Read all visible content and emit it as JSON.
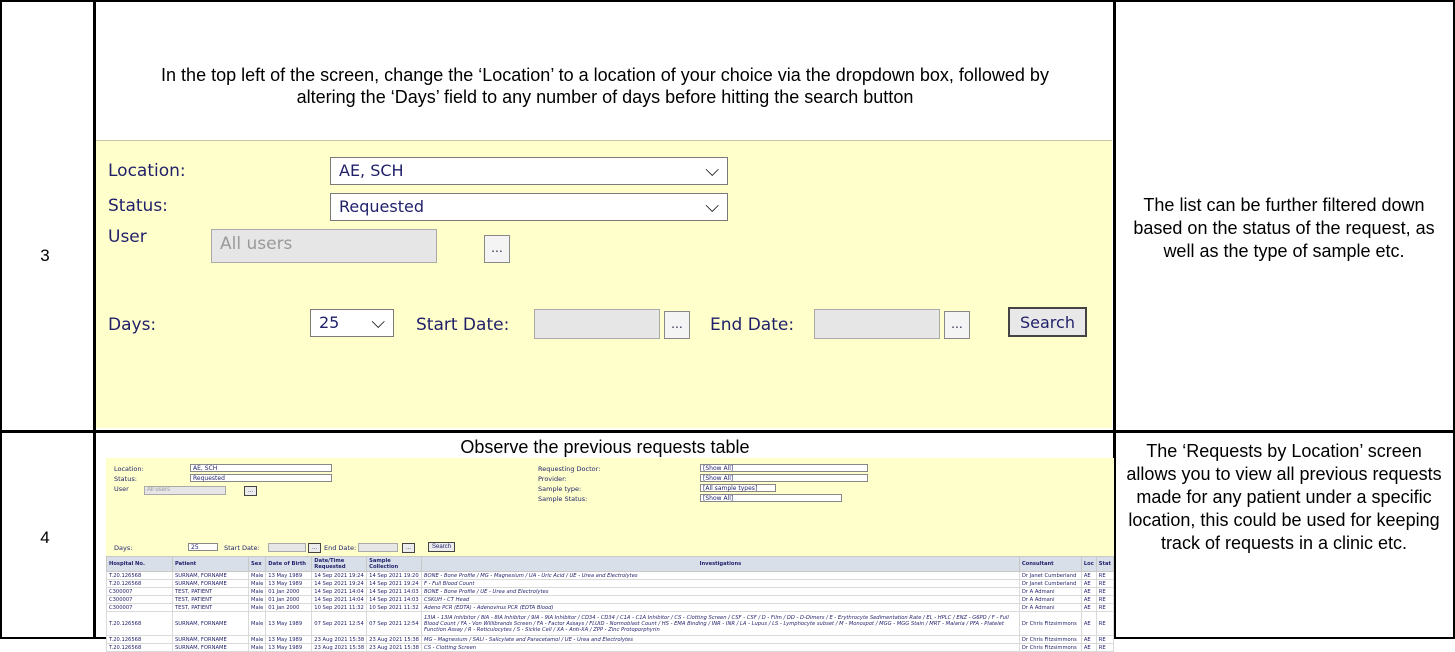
{
  "rows": [
    {
      "step": "3",
      "instruction": "In the top left of the screen, change the ‘Location’ to a location of your choice via the dropdown box, followed by altering the ‘Days’ field to any number of days before hitting the search button",
      "note": "The list can be further filtered down based on the status of the request, as well as the type of sample etc."
    },
    {
      "step": "4",
      "instruction": "Observe the previous requests table",
      "note": "The ‘Requests by Location’ screen allows you to view all previous requests made for any patient under a specific location, this could be used for keeping track of requests in a clinic etc."
    }
  ],
  "form": {
    "location_label": "Location:",
    "location_value": "AE, SCH",
    "status_label": "Status:",
    "status_value": "Requested",
    "user_label": "User",
    "user_placeholder": "All users",
    "days_label": "Days:",
    "days_value": "25",
    "start_date_label": "Start Date:",
    "end_date_label": "End Date:",
    "ellipsis": "...",
    "search_label": "Search",
    "requesting_doctor_label": "Requesting Doctor:",
    "provider_label": "Provider:",
    "sample_type_label": "Sample type:",
    "sample_status_label": "Sample Status:",
    "show_all": "[Show All]",
    "all_sample_types": "[All sample types]"
  },
  "table": {
    "headers": [
      "Hospital No.",
      "Patient",
      "Sex",
      "Date of Birth",
      "Date/Time Requested",
      "Sample Collection",
      "Investigations",
      "Consultant",
      "Loc",
      "Stat"
    ],
    "rows": [
      [
        "T.20.126568",
        "SURNAM, FORNAME",
        "Male",
        "13 May 1989",
        "14 Sep 2021 19:24",
        "14 Sep 2021 19:20",
        "BONE - Bone Profile / MG - Magnesium / UA - Uric Acid / UE - Urea and Electrolytes",
        "Dr Janet Cumberland",
        "AE",
        "RE"
      ],
      [
        "T.20.126568",
        "SURNAM, FORNAME",
        "Male",
        "13 May 1989",
        "14 Sep 2021 19:24",
        "14 Sep 2021 19:24",
        "F - Full Blood Count",
        "Dr Janet Cumberland",
        "AE",
        "RE"
      ],
      [
        "C300007",
        "TEST, PATIENT",
        "Male",
        "01 Jan 2000",
        "14 Sep 2021 14:04",
        "14 Sep 2021 14:03",
        "BONE - Bone Profile / UE - Urea and Electrolytes",
        "Dr A Admani",
        "AE",
        "RE"
      ],
      [
        "C300007",
        "TEST, PATIENT",
        "Male",
        "01 Jan 2000",
        "14 Sep 2021 14:04",
        "14 Sep 2021 14:03",
        "CSKUH - CT Head",
        "Dr A Admani",
        "AE",
        "RE"
      ],
      [
        "C300007",
        "TEST, PATIENT",
        "Male",
        "01 Jan 2000",
        "10 Sep 2021 11:32",
        "10 Sep 2021 11:32",
        "Adeno PCR (EDTA) - Adenovirus PCR (EDTA Blood)",
        "Dr A Admani",
        "AE",
        "RE"
      ],
      [
        "T.20.126568",
        "SURNAM, FORNAME",
        "Male",
        "13 May 1989",
        "07 Sep 2021 12:54",
        "07 Sep 2021 12:54",
        "13IA - 13IA Inhibitor / 8IA - 8IA Inhibitor / 9IA - 9IA Inhibitor / CD34 - CD34 / C1A - C1A Inhibitor / CS - Clotting Screen / CSF - CSF / D - Film / DD - D-Dimers / E - Erythrocyte Sedimentation Rate / EL - HPLC / ENZ - G6PD / F - Full Blood Count / FA - Von Willibrands Screen / FA - Factor Assays / FLUID - Normoblast Count / HS - EMA Binding / INR - INR / LA - Lupus / LS - Lymphocyte subset / M - Monospot / MGG - MGG Stain / MRT - Malaria / PFA - Platelet Function Assay / R - Reticulocytes / S - Sickle Cell / XA - Anti-XA / ZPP - Zinc Protoporphyrin",
        "Dr Chris Fitzsimmons",
        "AE",
        "RE"
      ],
      [
        "T.20.126568",
        "SURNAM, FORNAME",
        "Male",
        "13 May 1989",
        "23 Aug 2021 15:38",
        "23 Aug 2021 15:38",
        "MG - Magnesium / SALI - Salicylate and Paracetamol / UE - Urea and Electrolytes",
        "Dr Chris Fitzsimmons",
        "AE",
        "RE"
      ],
      [
        "T.20.126568",
        "SURNAM, FORNAME",
        "Male",
        "13 May 1989",
        "23 Aug 2021 15:38",
        "23 Aug 2021 15:38",
        "CS - Clotting Screen",
        "Dr Chris Fitzsimmons",
        "AE",
        "RE"
      ]
    ]
  }
}
